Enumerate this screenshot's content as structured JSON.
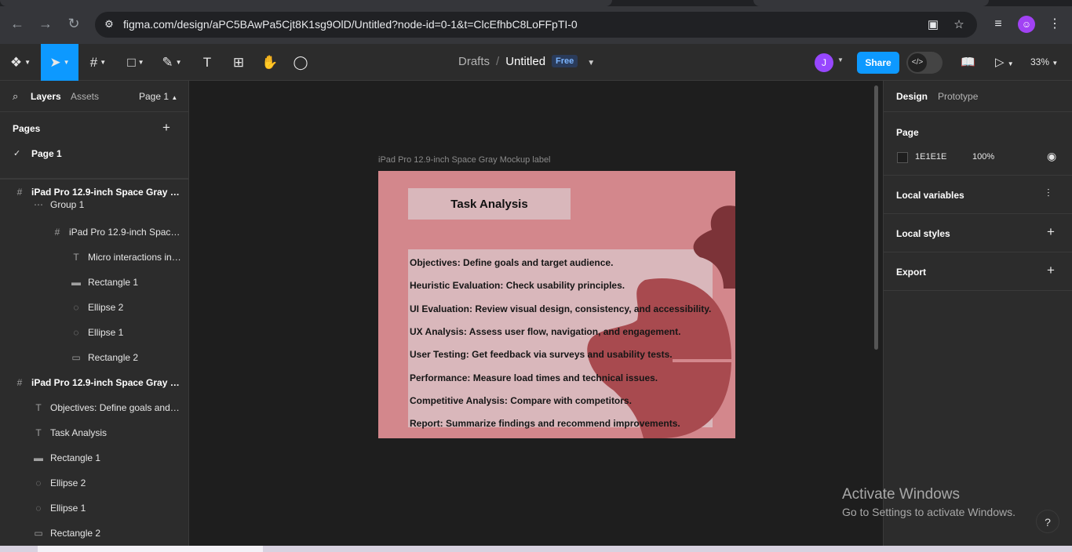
{
  "browser": {
    "url": "figma.com/design/aPC5BAwPa5Cjt8K1sg9OlD/Untitled?node-id=0-1&t=ClcEfhbC8LoFFpTI-0"
  },
  "toolbar": {
    "crumb_parent": "Drafts",
    "crumb_sep": "/",
    "file_title": "Untitled",
    "plan_badge": "Free",
    "avatar_letter": "J",
    "share_label": "Share",
    "zoom": "33%"
  },
  "left_panel": {
    "tab_layers": "Layers",
    "tab_assets": "Assets",
    "page_selector": "Page 1",
    "pages_header": "Pages",
    "pages": [
      {
        "label": "Page 1",
        "selected": true
      }
    ],
    "layers": [
      {
        "label": "iPad Pro 12.9-inch Space Gray Mo...",
        "icon": "frame-icon",
        "depth": 0,
        "frame": true
      },
      {
        "label": "Group 1",
        "icon": "group-icon",
        "depth": 1
      },
      {
        "label": "iPad Pro 12.9-inch Space ...",
        "icon": "frame-icon",
        "depth": 2
      },
      {
        "label": "Micro interactions in ...",
        "icon": "text-icon",
        "depth": 3
      },
      {
        "label": "Rectangle 1",
        "icon": "line-icon",
        "depth": 3
      },
      {
        "label": "Ellipse 2",
        "icon": "ellipse-icon",
        "depth": 3
      },
      {
        "label": "Ellipse 1",
        "icon": "ellipse-icon",
        "depth": 3
      },
      {
        "label": "Rectangle 2",
        "icon": "rectangle-icon",
        "depth": 3
      },
      {
        "label": "iPad Pro 12.9-inch Space Gray Mo...",
        "icon": "frame-icon",
        "depth": 0,
        "frame": true
      },
      {
        "label": "Objectives: Define goals and t...",
        "icon": "text-icon",
        "depth": 1
      },
      {
        "label": "Task Analysis",
        "icon": "text-icon",
        "depth": 1
      },
      {
        "label": "Rectangle 1",
        "icon": "line-icon",
        "depth": 1
      },
      {
        "label": "Ellipse 2",
        "icon": "ellipse-icon",
        "depth": 1
      },
      {
        "label": "Ellipse 1",
        "icon": "ellipse-icon",
        "depth": 1
      },
      {
        "label": "Rectangle 2",
        "icon": "rectangle-icon",
        "depth": 1
      }
    ]
  },
  "canvas": {
    "frame_label": "iPad Pro 12.9-inch Space Gray Mockup label",
    "artboard_title": "Task Analysis",
    "lines": [
      "Objectives: Define goals and target audience.",
      "Heuristic Evaluation: Check usability principles.",
      "UI Evaluation: Review visual design, consistency, and accessibility.",
      "UX Analysis: Assess user flow, navigation, and engagement.",
      "User Testing: Get feedback via surveys and usability tests.",
      "Performance: Measure load times and technical issues.",
      "Competitive Analysis: Compare with competitors.",
      "Report: Summarize findings and recommend improvements."
    ],
    "colors": {
      "artboard": "#d3878c",
      "panel": "#d9b7bb",
      "blob": "#a84a4f",
      "blob_dark": "#7c3338"
    }
  },
  "right_panel": {
    "tab_design": "Design",
    "tab_prototype": "Prototype",
    "page_header": "Page",
    "page_color_hex": "1E1E1E",
    "page_opacity": "100%",
    "local_variables": "Local variables",
    "local_styles": "Local styles",
    "export": "Export"
  },
  "os": {
    "activate_title": "Activate Windows",
    "activate_sub": "Go to Settings to activate Windows.",
    "help": "?"
  }
}
